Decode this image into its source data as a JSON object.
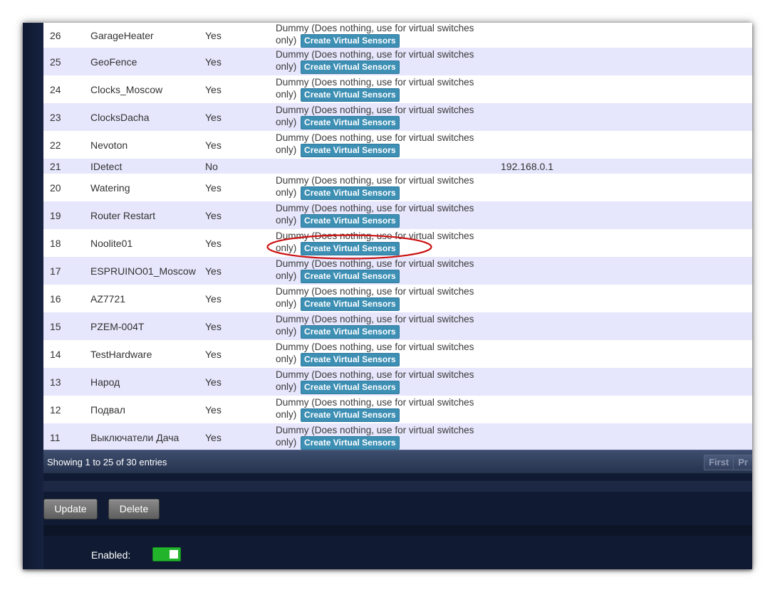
{
  "create_label": "Create Virtual Sensors",
  "rows": [
    {
      "idx": "26",
      "name": "GarageHeater",
      "enabled": "Yes",
      "type_l1": "Dummy (Does nothing, use for virtual switches",
      "type_l2": "only)",
      "address": ""
    },
    {
      "idx": "25",
      "name": "GeoFence",
      "enabled": "Yes",
      "type_l1": "Dummy (Does nothing, use for virtual switches",
      "type_l2": "only)",
      "address": ""
    },
    {
      "idx": "24",
      "name": "Clocks_Moscow",
      "enabled": "Yes",
      "type_l1": "Dummy (Does nothing, use for virtual switches",
      "type_l2": "only)",
      "address": ""
    },
    {
      "idx": "23",
      "name": "ClocksDacha",
      "enabled": "Yes",
      "type_l1": "Dummy (Does nothing, use for virtual switches",
      "type_l2": "only)",
      "address": ""
    },
    {
      "idx": "22",
      "name": "Nevoton",
      "enabled": "Yes",
      "type_l1": "Dummy (Does nothing, use for virtual switches",
      "type_l2": "only)",
      "address": ""
    },
    {
      "idx": "21",
      "name": "IDetect",
      "enabled": "No",
      "type_l1": "",
      "type_l2": "",
      "address": "192.168.0.1"
    },
    {
      "idx": "20",
      "name": "Watering",
      "enabled": "Yes",
      "type_l1": "Dummy (Does nothing, use for virtual switches",
      "type_l2": "only)",
      "address": ""
    },
    {
      "idx": "19",
      "name": "Router Restart",
      "enabled": "Yes",
      "type_l1": "Dummy (Does nothing, use for virtual switches",
      "type_l2": "only)",
      "address": ""
    },
    {
      "idx": "18",
      "name": "Noolite01",
      "enabled": "Yes",
      "type_l1": "Dummy (Does nothing, use for virtual switches",
      "type_l2": "only)",
      "address": ""
    },
    {
      "idx": "17",
      "name": "ESPRUINO01_Moscow",
      "enabled": "Yes",
      "type_l1": "Dummy (Does nothing, use for virtual switches",
      "type_l2": "only)",
      "address": ""
    },
    {
      "idx": "16",
      "name": "AZ7721",
      "enabled": "Yes",
      "type_l1": "Dummy (Does nothing, use for virtual switches",
      "type_l2": "only)",
      "address": ""
    },
    {
      "idx": "15",
      "name": "PZEM-004T",
      "enabled": "Yes",
      "type_l1": "Dummy (Does nothing, use for virtual switches",
      "type_l2": "only)",
      "address": ""
    },
    {
      "idx": "14",
      "name": "TestHardware",
      "enabled": "Yes",
      "type_l1": "Dummy (Does nothing, use for virtual switches",
      "type_l2": "only)",
      "address": ""
    },
    {
      "idx": "13",
      "name": "Народ",
      "enabled": "Yes",
      "type_l1": "Dummy (Does nothing, use for virtual switches",
      "type_l2": "only)",
      "address": ""
    },
    {
      "idx": "12",
      "name": "Подвал",
      "enabled": "Yes",
      "type_l1": "Dummy (Does nothing, use for virtual switches",
      "type_l2": "only)",
      "address": ""
    },
    {
      "idx": "11",
      "name": "Выключатели Дача",
      "enabled": "Yes",
      "type_l1": "Dummy (Does nothing, use for virtual switches",
      "type_l2": "only)",
      "address": ""
    }
  ],
  "footer": {
    "info": "Showing 1 to 25 of 30 entries",
    "first": "First",
    "prev": "Pr"
  },
  "buttons": {
    "update": "Update",
    "delete": "Delete"
  },
  "enabled_label": "Enabled:",
  "enabled_state": true,
  "colors": {
    "row_alt": "#e6e6fc",
    "button_blue": "#3d8fb4",
    "toggle_on": "#22b52c",
    "annotation": "#cc1111"
  }
}
